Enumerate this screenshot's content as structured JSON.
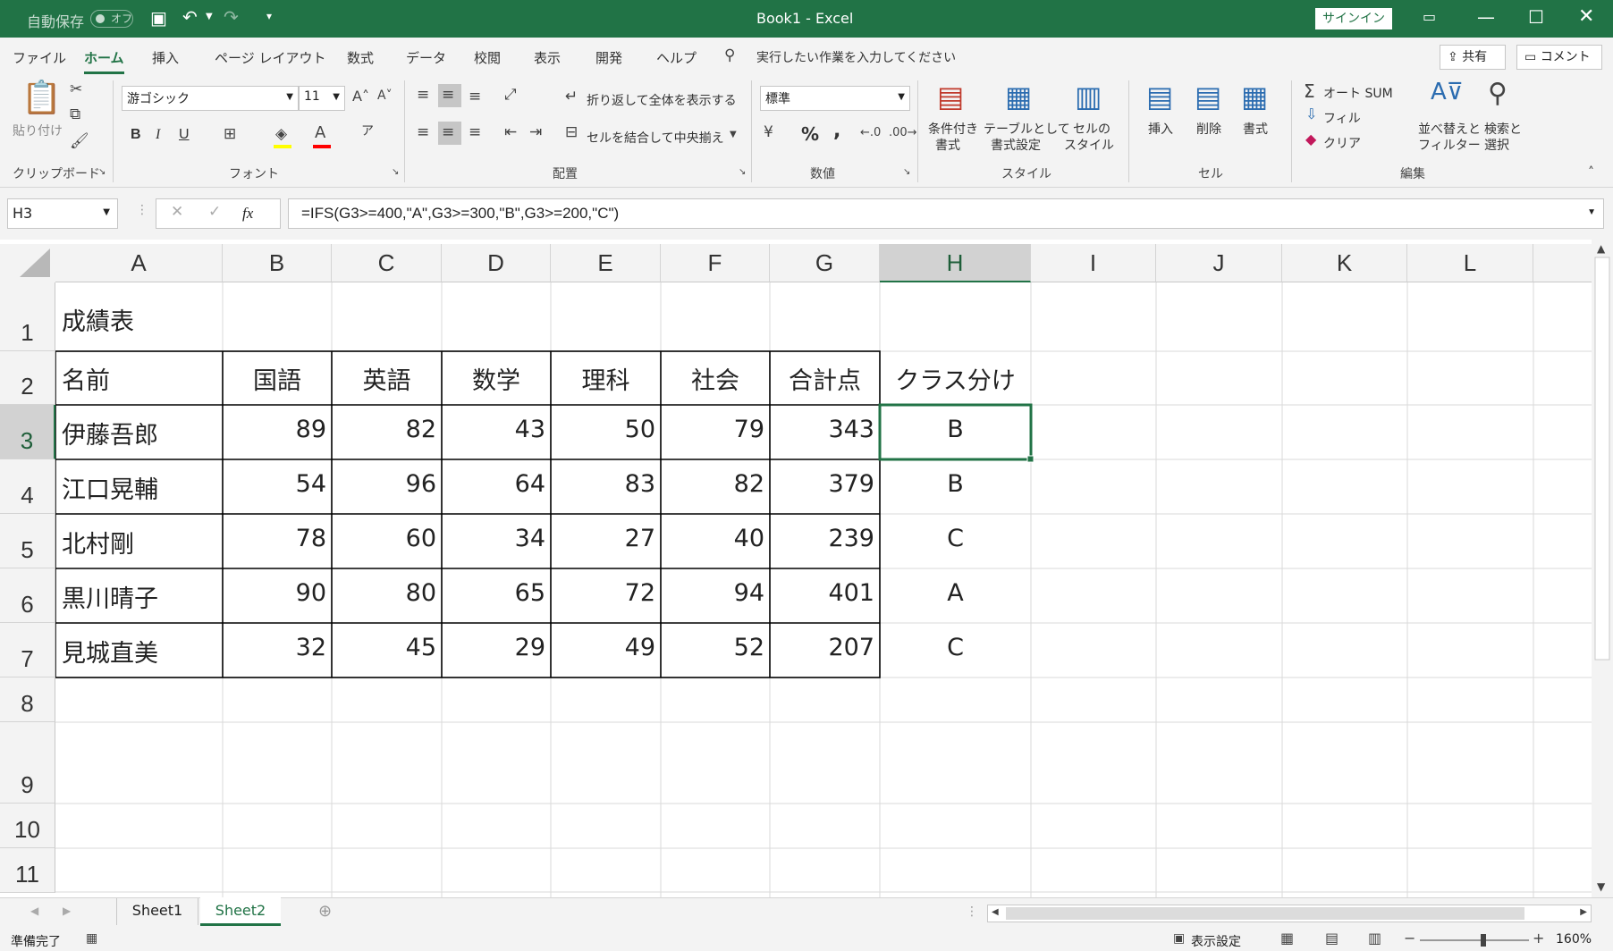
{
  "titlebar": {
    "autosave_label": "自動保存",
    "autosave_state": "オフ",
    "title": "Book1 - Excel",
    "signin": "サインイン"
  },
  "tabs": [
    "ファイル",
    "ホーム",
    "挿入",
    "ページ レイアウト",
    "数式",
    "データ",
    "校閲",
    "表示",
    "開発",
    "ヘルプ"
  ],
  "active_tab": "ホーム",
  "tell_me": "実行したい作業を入力してください",
  "share": "共有",
  "comments": "コメント",
  "ribbon": {
    "clipboard": {
      "paste": "貼り付け",
      "group": "クリップボード"
    },
    "font": {
      "name": "游ゴシック",
      "size": "11",
      "bold": "B",
      "italic": "I",
      "underline": "U",
      "group": "フォント"
    },
    "alignment": {
      "wrap": "折り返して全体を表示する",
      "merge": "セルを結合して中央揃え",
      "group": "配置"
    },
    "number": {
      "format": "標準",
      "percent": "%",
      "comma": ",",
      "group": "数値"
    },
    "styles": {
      "conditional": [
        "条件付き",
        "書式"
      ],
      "table": [
        "テーブルとして",
        "書式設定"
      ],
      "cellstyle": [
        "セルの",
        "スタイル"
      ],
      "group": "スタイル"
    },
    "cells": {
      "insert": "挿入",
      "delete": "削除",
      "format": "書式",
      "group": "セル"
    },
    "editing": {
      "autosum": "オート SUM",
      "fill": "フィル",
      "clear": "クリア",
      "sort": [
        "並べ替えと",
        "フィルター"
      ],
      "find": [
        "検索と",
        "選択"
      ],
      "group": "編集"
    }
  },
  "namebox": "H3",
  "formula": "=IFS(G3>=400,\"A\",G3>=300,\"B\",G3>=200,\"C\")",
  "fx": "fx",
  "columns": [
    "A",
    "B",
    "C",
    "D",
    "E",
    "F",
    "G",
    "H",
    "I",
    "J",
    "K",
    "L"
  ],
  "rows": [
    "1",
    "2",
    "3",
    "4",
    "5",
    "6",
    "7",
    "8",
    "9",
    "10",
    "11"
  ],
  "sheet": {
    "title": "成績表",
    "headers": [
      "名前",
      "国語",
      "英語",
      "数学",
      "理科",
      "社会",
      "合計点",
      "クラス分け"
    ],
    "records": [
      [
        "伊藤吾郎",
        "89",
        "82",
        "43",
        "50",
        "79",
        "343",
        "B"
      ],
      [
        "江口晃輔",
        "54",
        "96",
        "64",
        "83",
        "82",
        "379",
        "B"
      ],
      [
        "北村剛",
        "78",
        "60",
        "34",
        "27",
        "40",
        "239",
        "C"
      ],
      [
        "黒川晴子",
        "90",
        "80",
        "65",
        "72",
        "94",
        "401",
        "A"
      ],
      [
        "見城直美",
        "32",
        "45",
        "29",
        "49",
        "52",
        "207",
        "C"
      ]
    ]
  },
  "sheet_tabs": [
    "Sheet1",
    "Sheet2"
  ],
  "active_sheet": "Sheet2",
  "status": {
    "ready": "準備完了",
    "display_settings": "表示設定",
    "zoom": "160%"
  },
  "colors": {
    "accent": "#217346"
  }
}
